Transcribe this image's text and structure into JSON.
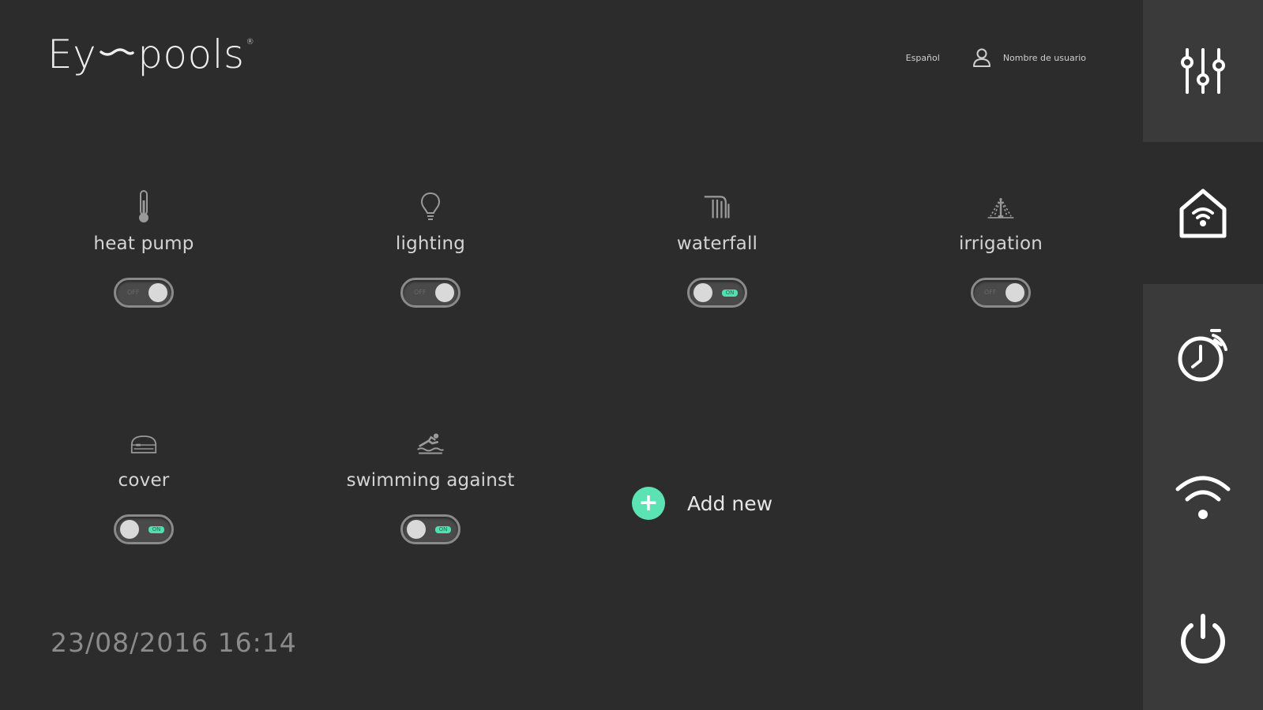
{
  "brand": {
    "logo_text_left": "Ey",
    "logo_text_right": "pools",
    "registered_mark": "®"
  },
  "header": {
    "language": "Español",
    "username": "Nombre de usuario"
  },
  "devices": [
    {
      "name": "heat pump",
      "icon": "thermometer-icon",
      "state": "off",
      "state_text": "OFF"
    },
    {
      "name": "lighting",
      "icon": "light-bulb-icon",
      "state": "off",
      "state_text": "OFF"
    },
    {
      "name": "waterfall",
      "icon": "waterfall-icon",
      "state": "on",
      "state_text": "ON"
    },
    {
      "name": "irrigation",
      "icon": "irrigation-icon",
      "state": "off",
      "state_text": "OFF"
    },
    {
      "name": "cover",
      "icon": "pool-cover-icon",
      "state": "on",
      "state_text": "ON"
    },
    {
      "name": "swimming against",
      "icon": "swimmer-icon",
      "state": "on",
      "state_text": "ON"
    }
  ],
  "add_new": {
    "label": "Add new",
    "icon": "plus-icon"
  },
  "status": {
    "datetime": "23/08/2016 16:14"
  },
  "sidebar": {
    "items": [
      {
        "icon": "sliders-icon",
        "active": false
      },
      {
        "icon": "smart-home-icon",
        "active": true
      },
      {
        "icon": "timer-icon",
        "active": false
      },
      {
        "icon": "wifi-icon",
        "active": false
      },
      {
        "icon": "power-icon",
        "active": false
      }
    ]
  },
  "colors": {
    "background": "#2c2c2c",
    "sidebar": "#3a3a3a",
    "accent": "#5be3b4",
    "text": "#d4d4d4",
    "muted": "#8b8b8b"
  }
}
